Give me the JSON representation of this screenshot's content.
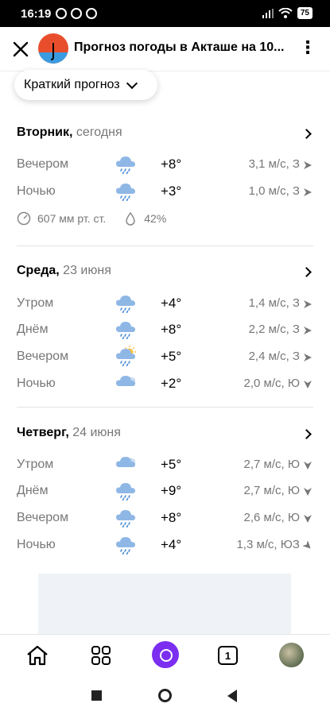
{
  "status_bar": {
    "time": "16:19",
    "battery": "75"
  },
  "header": {
    "title": "Прогноз погоды в Акташе на 10..."
  },
  "summary_button": {
    "label": "Краткий прогноз"
  },
  "days": [
    {
      "name": "Вторник,",
      "date": " сегодня",
      "rows": [
        {
          "period": "Вечером",
          "icon": "rain-cloud-icon",
          "temp": "+8°",
          "wind": "3,1 м/с, З",
          "wind_dir": "west-arrow-icon"
        },
        {
          "period": "Ночью",
          "icon": "rain-cloud-icon",
          "temp": "+3°",
          "wind": "1,0 м/с, З",
          "wind_dir": "west-arrow-icon"
        }
      ],
      "extras": {
        "pressure": "607 мм рт. ст.",
        "humidity": "42%"
      }
    },
    {
      "name": "Среда,",
      "date": " 23 июня",
      "rows": [
        {
          "period": "Утром",
          "icon": "rain-cloud-icon",
          "temp": "+4°",
          "wind": "1,4 м/с, З",
          "wind_dir": "west-arrow-icon"
        },
        {
          "period": "Днём",
          "icon": "rain-cloud-icon",
          "temp": "+8°",
          "wind": "2,2 м/с, З",
          "wind_dir": "west-arrow-icon"
        },
        {
          "period": "Вечером",
          "icon": "sun-rain-cloud-icon",
          "temp": "+5°",
          "wind": "2,4 м/с, З",
          "wind_dir": "west-arrow-icon"
        },
        {
          "period": "Ночью",
          "icon": "cloudy-icon",
          "temp": "+2°",
          "wind": "2,0 м/с, Ю",
          "wind_dir": "south-arrow-icon"
        }
      ]
    },
    {
      "name": "Четверг,",
      "date": " 24 июня",
      "rows": [
        {
          "period": "Утром",
          "icon": "cloudy-icon",
          "temp": "+5°",
          "wind": "2,7 м/с, Ю",
          "wind_dir": "south-arrow-icon"
        },
        {
          "period": "Днём",
          "icon": "rain-cloud-icon",
          "temp": "+9°",
          "wind": "2,7 м/с, Ю",
          "wind_dir": "south-arrow-icon"
        },
        {
          "period": "Вечером",
          "icon": "rain-cloud-icon",
          "temp": "+8°",
          "wind": "2,6 м/с, Ю",
          "wind_dir": "south-arrow-icon"
        },
        {
          "period": "Ночью",
          "icon": "rain-cloud-icon",
          "temp": "+4°",
          "wind": "1,3 м/с, ЮЗ",
          "wind_dir": "southwest-arrow-icon"
        }
      ]
    }
  ],
  "bottom_nav": {
    "tabs_count": "1"
  },
  "colors": {
    "rain_cloud": "#8fb7e6",
    "sun": "#f6c344",
    "muted_text": "#777777",
    "alice": "#7b2ef0"
  }
}
